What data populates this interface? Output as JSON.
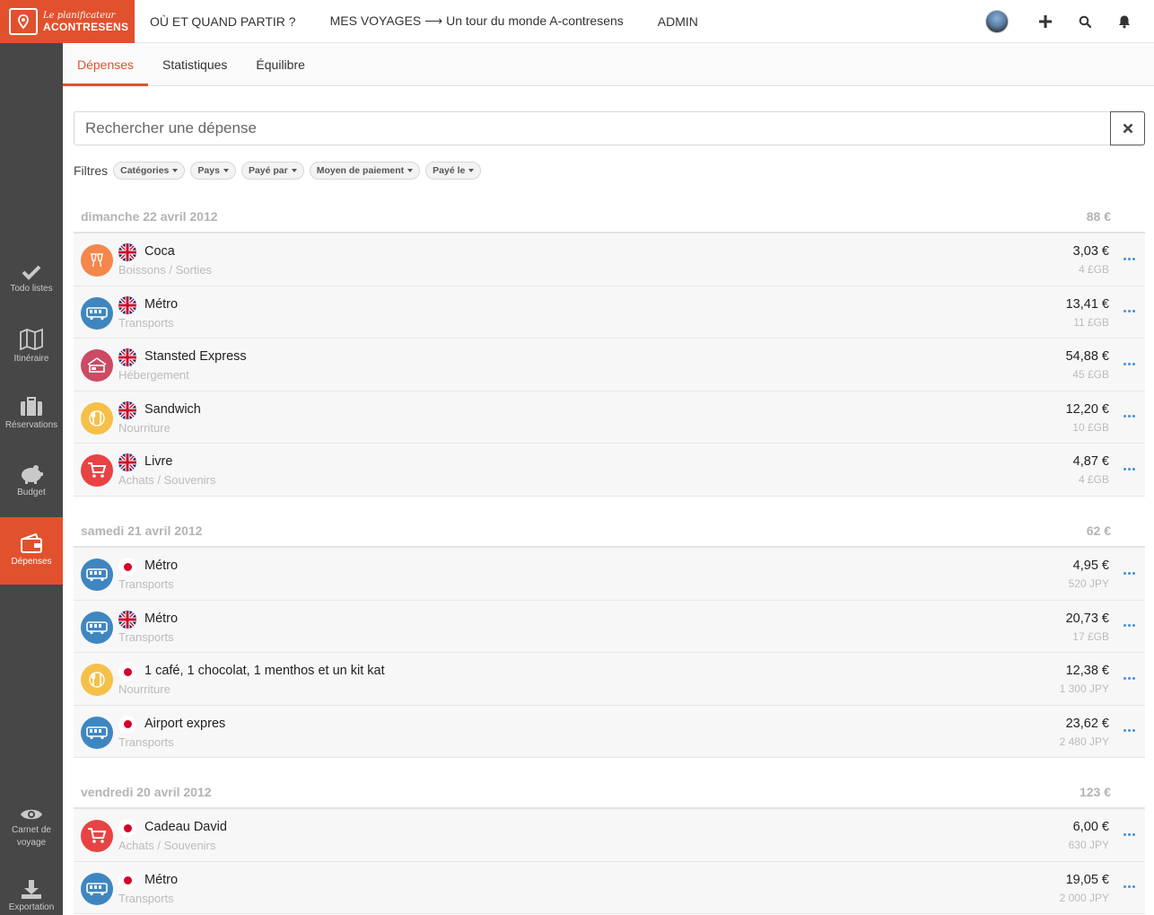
{
  "logo": {
    "line1": "Le planificateur",
    "line2": "ACONTRESENS"
  },
  "nav": {
    "where_when": "OÙ ET QUAND PARTIR ?",
    "trips": "MES VOYAGES ⟶ Un tour du monde A-contresens",
    "admin": "ADMIN"
  },
  "top_icons": [
    "avatar",
    "plus-icon",
    "search-icon",
    "bell-icon"
  ],
  "sidebar": {
    "items": [
      {
        "label": "Todo listes",
        "icon": "check-icon"
      },
      {
        "label": "Itinéraire",
        "icon": "map-icon"
      },
      {
        "label": "Réservations",
        "icon": "suitcase-icon"
      },
      {
        "label": "Budget",
        "icon": "piggy-bank-icon"
      },
      {
        "label": "Dépenses",
        "icon": "wallet-icon",
        "active": true
      }
    ],
    "bottom": [
      {
        "label": "Carnet de voyage",
        "icon": "eye-icon"
      },
      {
        "label": "Exportation",
        "icon": "download-icon"
      }
    ]
  },
  "tabs": [
    {
      "label": "Dépenses",
      "active": true
    },
    {
      "label": "Statistiques"
    },
    {
      "label": "Équilibre"
    }
  ],
  "search": {
    "placeholder": "Rechercher une dépense",
    "value": ""
  },
  "filters": {
    "label": "Filtres",
    "chips": [
      "Catégories",
      "Pays",
      "Payé par",
      "Moyen de paiement",
      "Payé le"
    ]
  },
  "colors": {
    "accent": "#e2512d",
    "boissons": "#f4874b",
    "transports": "#3f86c1",
    "hebergement": "#cc4a63",
    "nourriture": "#f5c04a",
    "achats": "#e84343",
    "more": "#4a90d9"
  },
  "days": [
    {
      "title": "dimanche 22 avril 2012",
      "total": "88 €",
      "expenses": [
        {
          "name": "Coca",
          "category": "Boissons / Sorties",
          "cat": "boissons",
          "flag": "gb",
          "amount": "3,03 €",
          "original": "4 £GB"
        },
        {
          "name": "Métro",
          "category": "Transports",
          "cat": "transports",
          "flag": "gb",
          "amount": "13,41 €",
          "original": "11 £GB"
        },
        {
          "name": "Stansted Express",
          "category": "Hébergement",
          "cat": "hebergement",
          "flag": "gb",
          "amount": "54,88 €",
          "original": "45 £GB"
        },
        {
          "name": "Sandwich",
          "category": "Nourriture",
          "cat": "nourriture",
          "flag": "gb",
          "amount": "12,20 €",
          "original": "10 £GB"
        },
        {
          "name": "Livre",
          "category": "Achats / Souvenirs",
          "cat": "achats",
          "flag": "gb",
          "amount": "4,87 €",
          "original": "4 £GB"
        }
      ]
    },
    {
      "title": "samedi 21 avril 2012",
      "total": "62 €",
      "expenses": [
        {
          "name": "Métro",
          "category": "Transports",
          "cat": "transports",
          "flag": "jp",
          "amount": "4,95 €",
          "original": "520 JPY"
        },
        {
          "name": "Métro",
          "category": "Transports",
          "cat": "transports",
          "flag": "gb",
          "amount": "20,73 €",
          "original": "17 £GB"
        },
        {
          "name": "1 café, 1 chocolat, 1 menthos et un kit kat",
          "category": "Nourriture",
          "cat": "nourriture",
          "flag": "jp",
          "amount": "12,38 €",
          "original": "1 300 JPY"
        },
        {
          "name": "Airport expres",
          "category": "Transports",
          "cat": "transports",
          "flag": "jp",
          "amount": "23,62 €",
          "original": "2 480 JPY"
        }
      ]
    },
    {
      "title": "vendredi 20 avril 2012",
      "total": "123 €",
      "expenses": [
        {
          "name": "Cadeau David",
          "category": "Achats / Souvenirs",
          "cat": "achats",
          "flag": "jp",
          "amount": "6,00 €",
          "original": "630 JPY"
        },
        {
          "name": "Métro",
          "category": "Transports",
          "cat": "transports",
          "flag": "jp",
          "amount": "19,05 €",
          "original": "2 000 JPY"
        }
      ]
    }
  ]
}
